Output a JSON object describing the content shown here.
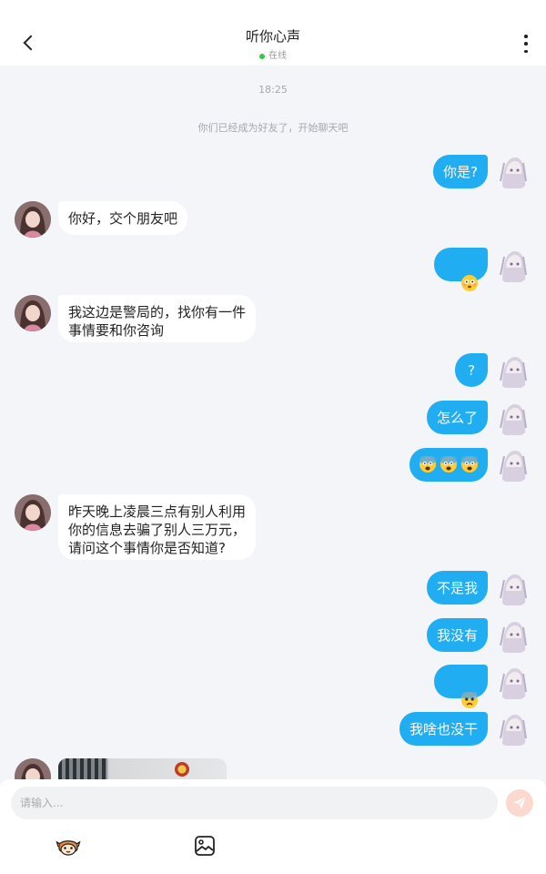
{
  "header": {
    "title": "听你心声",
    "status": "在线",
    "back_icon": "chevron-left-icon",
    "more_icon": "more-vertical-icon"
  },
  "chat": {
    "timestamp": "18:25",
    "system_notice": "你们已经成为好友了，开始聊天吧",
    "messages": [
      {
        "from": "me",
        "text": "你是?"
      },
      {
        "from": "them",
        "text": "你好，交个朋友吧"
      },
      {
        "from": "me",
        "emoji": [
          "flushed-face-icon"
        ]
      },
      {
        "from": "them",
        "text": "我这边是警局的，找你有一件\n事情要和你咨询"
      },
      {
        "from": "me",
        "text": "?"
      },
      {
        "from": "me",
        "text": "怎么了"
      },
      {
        "from": "me",
        "emoji": [
          "scared-face-icon",
          "scared-face-icon",
          "scared-face-icon"
        ]
      },
      {
        "from": "them",
        "text": "昨天晚上凌晨三点有别人利用\n你的信息去骗了别人三万元，\n请问这个事情你是否知道?"
      },
      {
        "from": "me",
        "text": "不是我"
      },
      {
        "from": "me",
        "text": "我没有"
      },
      {
        "from": "me",
        "emoji": [
          "anxious-face-icon"
        ]
      },
      {
        "from": "me",
        "text": "我啥也没干"
      },
      {
        "from": "them",
        "image": "police-photo"
      }
    ]
  },
  "input": {
    "placeholder": "请输入...",
    "send_icon": "send-icon"
  },
  "toolbar": {
    "emoji_icon": "emoji-icon",
    "image_icon": "image-icon"
  },
  "colors": {
    "accent": "#20adf2",
    "background": "#f4f5f9",
    "online": "#2ecc40",
    "send_button": "#fbd9cf"
  }
}
